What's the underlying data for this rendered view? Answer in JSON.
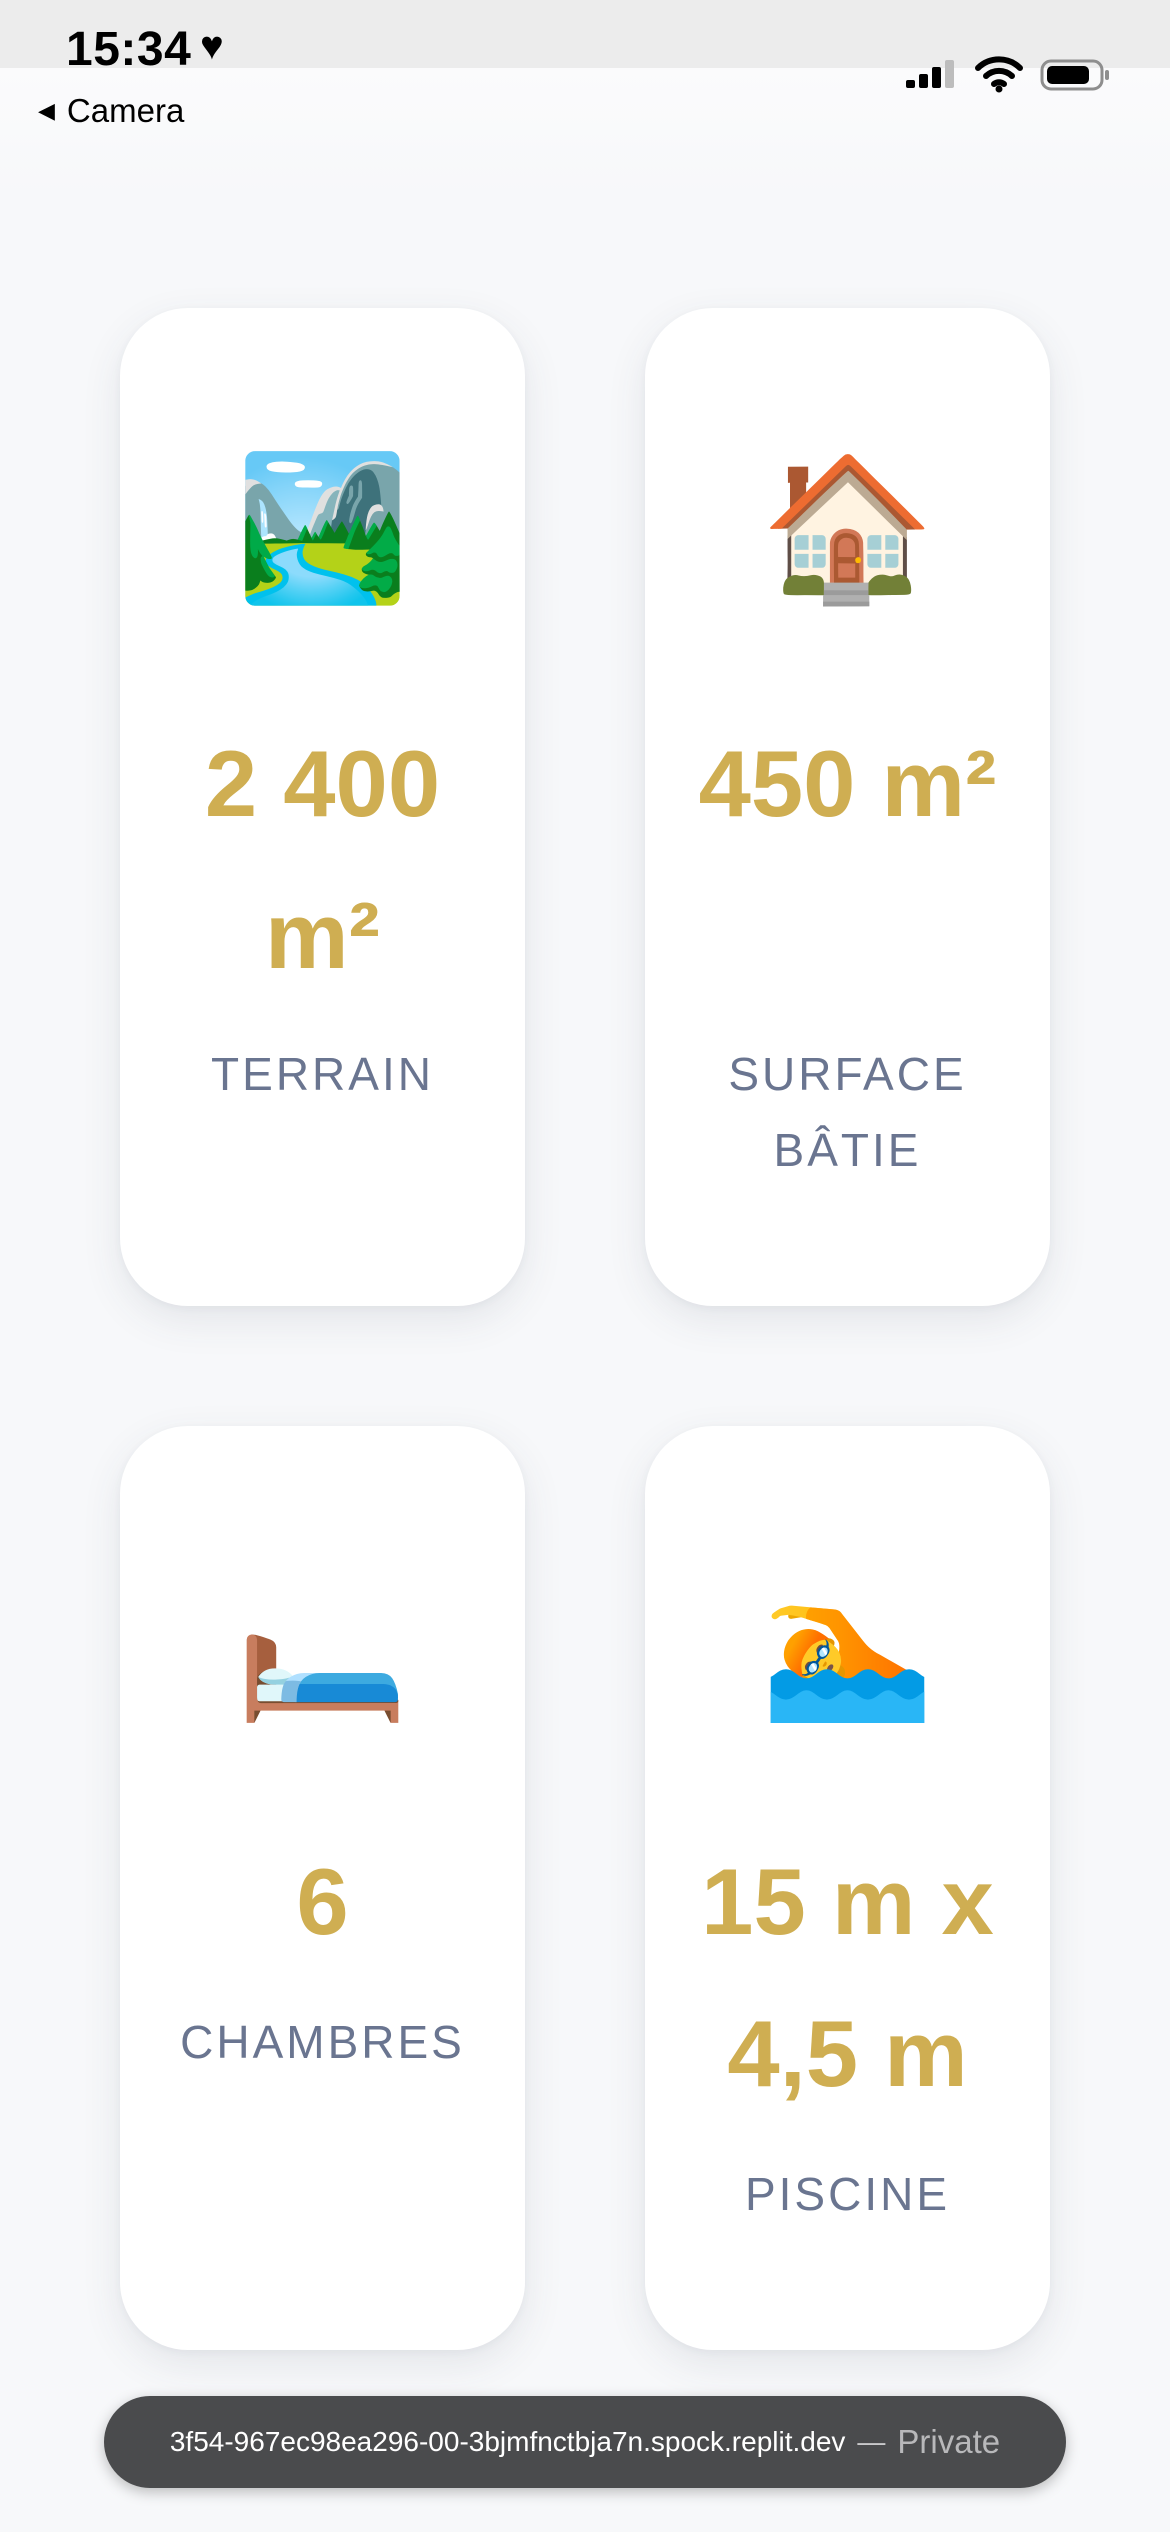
{
  "status_bar": {
    "time": "15:34",
    "heart_icon": "♥",
    "back_label": "Camera",
    "back_arrow": "◀",
    "icons": [
      "cellular-signal-icon",
      "wifi-icon",
      "battery-icon"
    ]
  },
  "cards": [
    {
      "id": "terrain",
      "emoji": "🏞️",
      "icon_name": "national-park-icon",
      "value": "2 400 m²",
      "label": "TERRAIN"
    },
    {
      "id": "surface",
      "emoji": "🏠",
      "icon_name": "house-icon",
      "value": "450 m²",
      "label": "SURFACE BÂTIE"
    },
    {
      "id": "chambres",
      "emoji": "🛏️",
      "icon_name": "bed-icon",
      "value": "6",
      "label": "CHAMBRES"
    },
    {
      "id": "piscine",
      "emoji": "🏊",
      "icon_name": "swimmer-icon",
      "value": "15 m x 4,5 m",
      "label": "PISCINE"
    }
  ],
  "url_bar": {
    "url": "3f54-967ec98ea296-00-3bjmfnctbja7n.spock.replit.dev",
    "separator": "—",
    "mode": "Private"
  },
  "colors": {
    "accent_gold": "#cfae52",
    "label_gray": "#6a7590",
    "background": "#f7f8fa",
    "card": "#ffffff",
    "url_bar": "#4a4b4d"
  }
}
